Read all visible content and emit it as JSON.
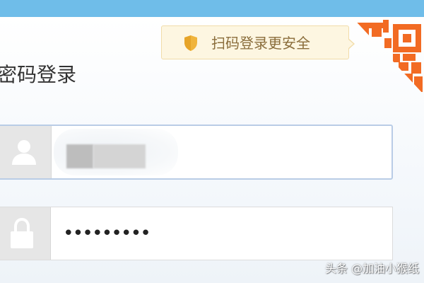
{
  "header": {
    "bar_color": "#6fbde9"
  },
  "qr_tip": {
    "text": "扫码登录更安全",
    "icon": "shield-icon",
    "accent_color": "#f0b43c"
  },
  "qr_corner": {
    "icon": "qr-code-icon",
    "color": "#f26b23"
  },
  "login": {
    "title": "密码登录",
    "username": {
      "icon": "user-icon",
      "value_blurred": true
    },
    "password": {
      "icon": "lock-icon",
      "masked_value": "•••••••••"
    }
  },
  "watermark": {
    "text": "头条 @加油小猴纸"
  }
}
